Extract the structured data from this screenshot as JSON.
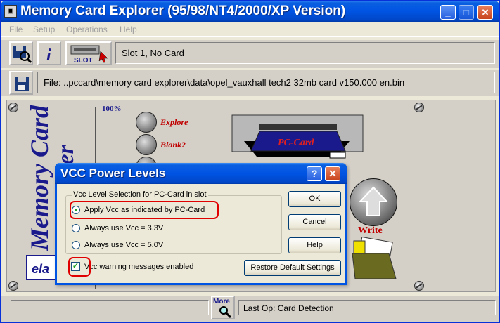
{
  "window": {
    "title": "Memory Card Explorer (95/98/NT4/2000/XP Version)",
    "minimize": "_",
    "maximize": "□",
    "close": "✕"
  },
  "menu": [
    "File",
    "Setup",
    "Operations",
    "Help"
  ],
  "toolbar": {
    "slot_label": "SLOT",
    "slot_status": "Slot 1, No Card",
    "file_path": "File: ..pccard\\memory card explorer\\data\\opel_vauxhall tech2 32mb card v150.000 en.bin"
  },
  "panel": {
    "vertical_title_1": "Memory Card",
    "vertical_title_2": "Explorer",
    "meter_top": "100%",
    "actions": [
      "Explore",
      "Blank?"
    ],
    "card_label": "PC-Card",
    "write_label": "Write",
    "logo_text": "ela"
  },
  "statusbar": {
    "more_label": "More",
    "last_op": "Last Op: Card Detection"
  },
  "dialog": {
    "title": "VCC Power Levels",
    "help_glyph": "?",
    "close_glyph": "✕",
    "group_label": "Vcc Level Selection for PC-Card in slot",
    "options": [
      {
        "label": "Apply Vcc as indicated by PC-Card",
        "selected": true
      },
      {
        "label": "Always use Vcc = 3.3V",
        "selected": false
      },
      {
        "label": "Always use Vcc = 5.0V",
        "selected": false
      }
    ],
    "warning_checkbox": {
      "label": "Vcc warning messages enabled",
      "checked": true,
      "mark": "✓"
    },
    "buttons": {
      "ok": "OK",
      "cancel": "Cancel",
      "help": "Help",
      "restore": "Restore Default Settings"
    }
  },
  "colors": {
    "xp_blue": "#0054e3",
    "annotation_red": "#e00000",
    "title_navy": "#1a1a8c"
  }
}
